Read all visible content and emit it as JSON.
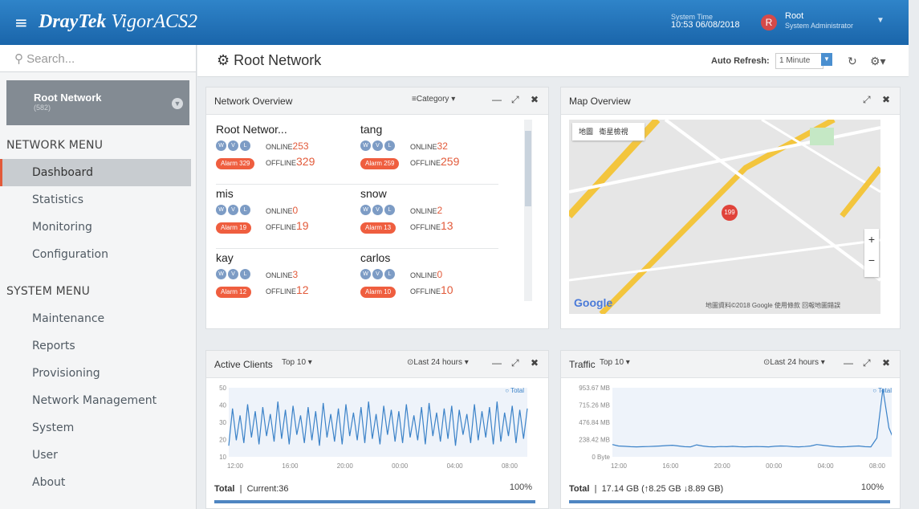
{
  "brand": {
    "name_bold": "DrayTek",
    "name_rest": "VigorACS2"
  },
  "system_time": {
    "label": "System Time",
    "value": "10:53 06/08/2018"
  },
  "user": {
    "initial": "R",
    "name": "Root",
    "role": "System Administrator"
  },
  "search": {
    "placeholder": "Search..."
  },
  "network": {
    "name": "Root Network",
    "count": "(582)"
  },
  "menus": {
    "network_header": "NETWORK MENU",
    "network_items": [
      "Dashboard",
      "Statistics",
      "Monitoring",
      "Configuration"
    ],
    "system_header": "SYSTEM MENU",
    "system_items": [
      "Maintenance",
      "Reports",
      "Provisioning",
      "Network Management",
      "System",
      "User",
      "About"
    ]
  },
  "page": {
    "title": "Root Network",
    "auto_refresh_label": "Auto Refresh:",
    "auto_refresh_value": "1 Minute"
  },
  "overview": {
    "title": "Network Overview",
    "category": "Category",
    "badge_labels": [
      "W",
      "V",
      "L"
    ],
    "online_label": "ONLINE",
    "offline_label": "OFFLINE",
    "networks": [
      {
        "name": "Root Networ...",
        "online": "253",
        "offline": "329",
        "alarm": "Alarm 329"
      },
      {
        "name": "tang",
        "online": "32",
        "offline": "259",
        "alarm": "Alarm 259"
      },
      {
        "name": "mis",
        "online": "0",
        "offline": "19",
        "alarm": "Alarm 19"
      },
      {
        "name": "snow",
        "online": "2",
        "offline": "13",
        "alarm": "Alarm 13"
      },
      {
        "name": "kay",
        "online": "3",
        "offline": "12",
        "alarm": "Alarm 12"
      },
      {
        "name": "carlos",
        "online": "0",
        "offline": "10",
        "alarm": "Alarm 10"
      }
    ]
  },
  "map": {
    "title": "Map Overview",
    "btn_map": "地圖",
    "btn_sat": "衛星檢視",
    "pin": "199",
    "google": "Google",
    "copyright": "地圖資料©2018 Google 使用條款 回報地圖錯誤"
  },
  "clients": {
    "title": "Active Clients",
    "top": "Top 10",
    "range": "Last 24 hours",
    "legend": "Total",
    "footer_label": "Total",
    "footer_value": "Current:36",
    "pct": "100%"
  },
  "traffic": {
    "title": "Traffic",
    "top": "Top 10",
    "range": "Last 24 hours",
    "legend": "Total",
    "footer_label": "Total",
    "footer_value": "17.14 GB (↑8.25 GB ↓8.89 GB)",
    "pct": "100%"
  },
  "chart_data": [
    {
      "type": "line",
      "title": "Active Clients",
      "yticks": [
        "50",
        "40",
        "30",
        "20",
        "10"
      ],
      "ylim": [
        0,
        50
      ],
      "xticks": [
        "12:00",
        "16:00",
        "20:00",
        "00:00",
        "04:00",
        "08:00"
      ],
      "series": [
        {
          "name": "Total",
          "values": [
            8,
            35,
            12,
            30,
            10,
            38,
            14,
            33,
            9,
            36,
            15,
            31,
            11,
            40,
            13,
            34,
            9,
            37,
            16,
            30,
            10,
            36,
            12,
            33,
            8,
            39,
            14,
            31,
            11,
            35,
            9,
            38,
            15,
            32,
            12,
            36,
            10,
            40,
            13,
            31,
            9,
            37,
            16,
            34,
            11,
            33,
            10,
            38,
            14,
            30,
            12,
            36,
            9,
            39,
            15,
            32,
            11,
            35,
            13,
            37,
            8,
            34,
            16,
            31,
            10,
            38,
            12,
            33,
            14,
            36,
            9,
            40,
            11,
            32,
            15,
            37,
            10,
            34,
            13,
            35
          ]
        }
      ]
    },
    {
      "type": "line",
      "title": "Traffic",
      "yticks": [
        "953.67 MB",
        "715.26 MB",
        "476.84 MB",
        "238.42 MB",
        "0 Byte"
      ],
      "ylim": [
        0,
        953.67
      ],
      "xticks": [
        "12:00",
        "16:00",
        "20:00",
        "00:00",
        "04:00",
        "08:00"
      ],
      "series": [
        {
          "name": "Total",
          "values": [
            170,
            150,
            145,
            140,
            138,
            140,
            142,
            145,
            150,
            155,
            160,
            150,
            140,
            138,
            165,
            150,
            140,
            138,
            142,
            140,
            145,
            140,
            138,
            140,
            142,
            140,
            138,
            145,
            150,
            148,
            140,
            138,
            142,
            150,
            170,
            160,
            150,
            140,
            138,
            140,
            145,
            150,
            140,
            138,
            260,
            940,
            400,
            200
          ]
        }
      ]
    }
  ]
}
